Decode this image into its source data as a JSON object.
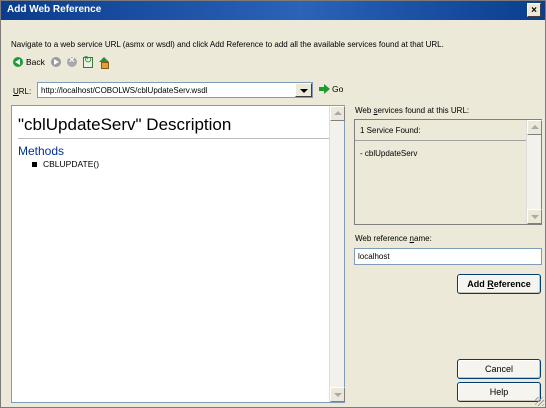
{
  "window": {
    "title": "Add Web Reference",
    "close_label": "×"
  },
  "instruction": "Navigate to a web service URL (asmx or wsdl) and click Add Reference to add all the available services found at that URL.",
  "toolbar": {
    "back_label": "Back",
    "icons": [
      "back-arrow",
      "forward-arrow",
      "stop",
      "refresh",
      "home"
    ]
  },
  "url": {
    "label_u": "U",
    "label_rest": "RL:",
    "value": "http://localhost/COBOLWS/cblUpdateServ.wsdl",
    "go_label": "Go"
  },
  "browser": {
    "description_title": "\"cblUpdateServ\" Description",
    "methods_heading": "Methods",
    "methods": [
      "CBLUPDATE()"
    ]
  },
  "services": {
    "label_pre": "Web ",
    "label_u": "s",
    "label_post": "ervices found at this URL:",
    "count_text": "1 Service Found:",
    "items": [
      "- cblUpdateServ"
    ]
  },
  "reference": {
    "label_pre": "Web reference ",
    "label_u": "n",
    "label_post": "ame:",
    "value": "localhost"
  },
  "buttons": {
    "add_pre": "Add ",
    "add_u": "R",
    "add_post": "eference",
    "cancel": "Cancel",
    "help": "Help"
  },
  "colors": {
    "titlebar": "#0b3c8c",
    "dialog_bg": "#ece9d8",
    "methods_heading": "#003399"
  }
}
